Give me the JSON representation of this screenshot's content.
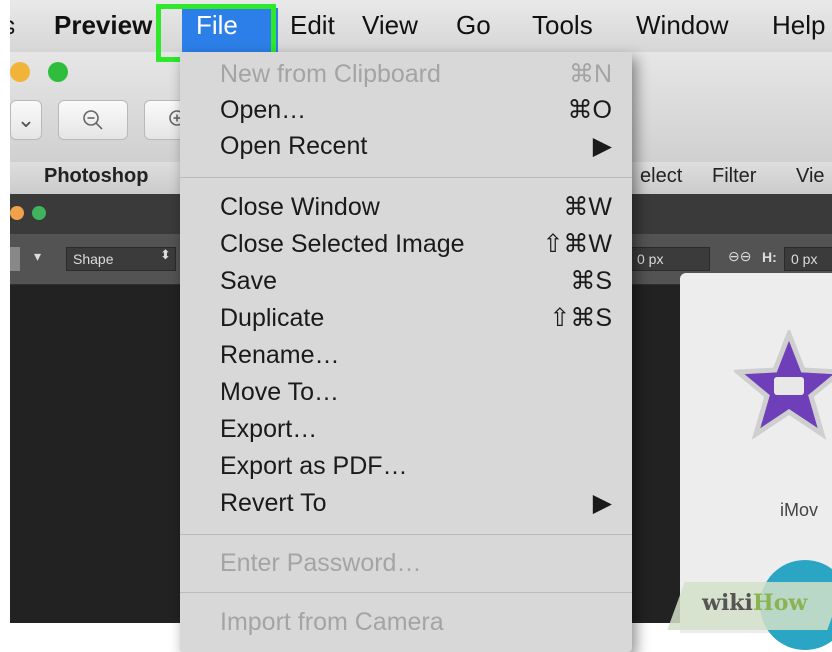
{
  "menubar": {
    "apple_fragment": "ɕ",
    "app_name": "Preview",
    "items": [
      "File",
      "Edit",
      "View",
      "Go",
      "Tools",
      "Window",
      "Help"
    ]
  },
  "preview_toolbar": {
    "dropdown_icon": "⌄",
    "zoom_out_icon": "zoom-out-icon",
    "zoom_in_icon": "zoom-in-icon"
  },
  "tabs": {
    "photoshop": "Photoshop",
    "select": "elect",
    "filter": "Filter",
    "view": "Vie"
  },
  "photoshop": {
    "shape_mode": "Shape",
    "width_value": "0 px",
    "h_label": "H:",
    "height_value": "0 px"
  },
  "desktop": {
    "imovie_label": "iMov"
  },
  "watermark": {
    "wiki": "wiki",
    "how": "How"
  },
  "file_menu": {
    "items": [
      {
        "label": "New from Clipboard",
        "shortcut": "⌘N",
        "disabled": true
      },
      {
        "label": "Open…",
        "shortcut": "⌘O"
      },
      {
        "label": "Open Recent",
        "shortcut": "▶"
      },
      {
        "label": "Close Window",
        "shortcut": "⌘W"
      },
      {
        "label": "Close Selected Image",
        "shortcut": "⇧⌘W"
      },
      {
        "label": "Save",
        "shortcut": "⌘S"
      },
      {
        "label": "Duplicate",
        "shortcut": "⇧⌘S"
      },
      {
        "label": "Rename…",
        "shortcut": ""
      },
      {
        "label": "Move To…",
        "shortcut": ""
      },
      {
        "label": "Export…",
        "shortcut": ""
      },
      {
        "label": "Export as PDF…",
        "shortcut": ""
      },
      {
        "label": "Revert To",
        "shortcut": "▶"
      },
      {
        "label": "Enter Password…",
        "shortcut": "",
        "disabled": true
      },
      {
        "label": "Import from Camera",
        "shortcut": "",
        "disabled": true
      }
    ]
  },
  "colors": {
    "selected_menu": "#2c7fe8",
    "highlight_box": "#2ee82b"
  }
}
